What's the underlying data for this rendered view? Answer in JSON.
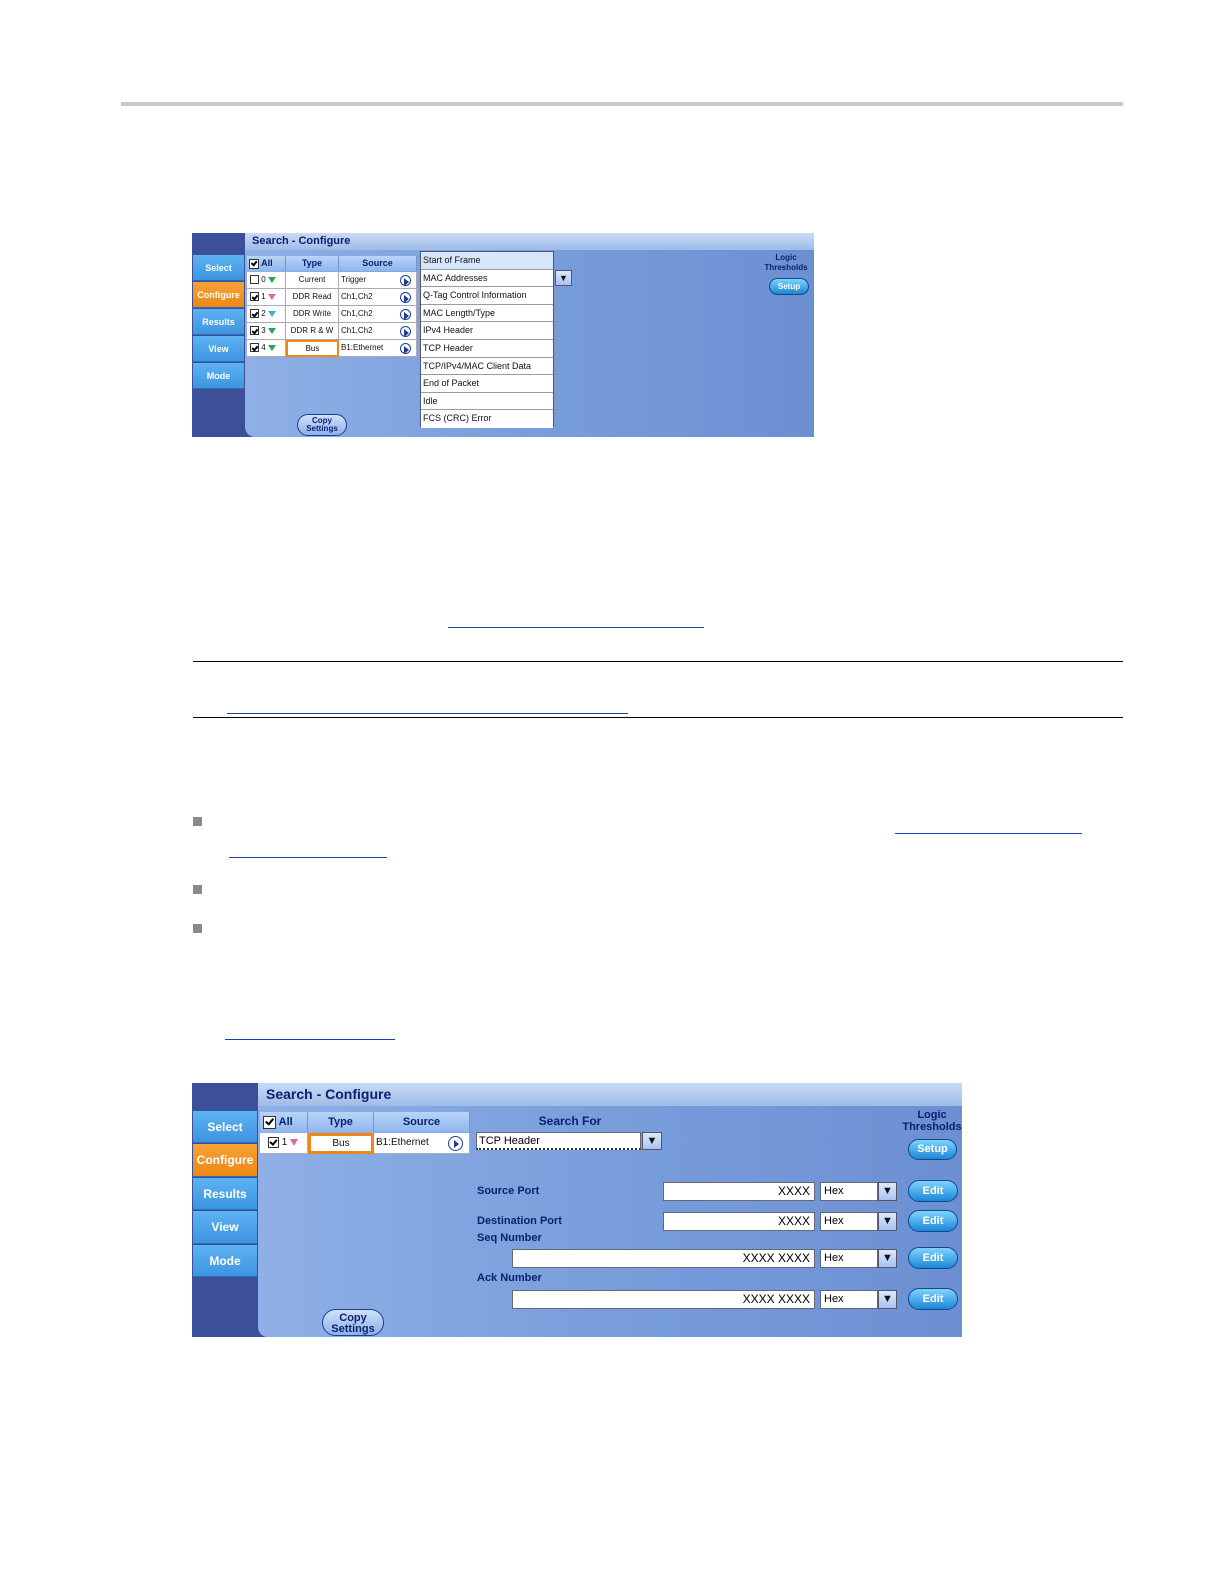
{
  "panel1": {
    "title": "Search - Configure",
    "tabs": [
      "Select",
      "Configure",
      "Results",
      "View",
      "Mode"
    ],
    "headers": {
      "all": "All",
      "type": "Type",
      "source": "Source"
    },
    "rows": [
      {
        "num": "0",
        "type": "Current",
        "source": "Trigger"
      },
      {
        "num": "1",
        "type": "DDR Read",
        "source": "Ch1,Ch2"
      },
      {
        "num": "2",
        "type": "DDR Write",
        "source": "Ch1,Ch2"
      },
      {
        "num": "3",
        "type": "DDR R & W",
        "source": "Ch1,Ch2"
      },
      {
        "num": "4",
        "type": "Bus",
        "source": "B1:Ethernet"
      }
    ],
    "list": [
      "Start of Frame",
      "MAC Addresses",
      "Q-Tag Control Information",
      "MAC Length/Type",
      "IPv4 Header",
      "TCP Header",
      "TCP/IPv4/MAC Client Data",
      "End of Packet",
      "Idle",
      "FCS (CRC) Error"
    ],
    "logic": "Logic Thresholds",
    "setup": "Setup",
    "copy": "Copy Settings",
    "dropdown_arrow": "▼"
  },
  "panel2": {
    "title": "Search - Configure",
    "tabs": [
      "Select",
      "Configure",
      "Results",
      "View",
      "Mode"
    ],
    "headers": {
      "all": "All",
      "type": "Type",
      "source": "Source"
    },
    "row": {
      "num": "1",
      "type": "Bus",
      "source": "B1:Ethernet"
    },
    "search_for_label": "Search For",
    "search_for_value": "TCP Header",
    "logic": "Logic Thresholds",
    "setup": "Setup",
    "copy": "Copy Settings",
    "edit": "Edit",
    "format": "Hex",
    "dropdown_arrow": "▼",
    "fields": [
      {
        "label": "Source Port",
        "value": "XXXX"
      },
      {
        "label": "Destination Port",
        "value": "XXXX"
      },
      {
        "label": "Seq Number",
        "value": "XXXX XXXX"
      },
      {
        "label": "Ack Number",
        "value": "XXXX XXXX"
      }
    ]
  }
}
